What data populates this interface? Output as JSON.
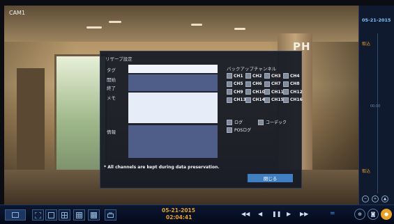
{
  "camera": {
    "label": "CAM1",
    "sign_text": "PH"
  },
  "dialog": {
    "title": "リザーブ設定",
    "fields": {
      "tag": "タグ",
      "start": "開始",
      "end": "終了",
      "memo": "メモ",
      "info": "情報"
    },
    "backup_title": "バックアップチャンネル",
    "channels": [
      "CH1",
      "CH2",
      "CH3",
      "CH4",
      "CH5",
      "CH6",
      "CH7",
      "CH8",
      "CH9",
      "CH10",
      "CH11",
      "CH12",
      "CH13",
      "CH14",
      "CH15",
      "CH16"
    ],
    "options": {
      "log": "ログ",
      "codec": "コーデック",
      "pos_log": "POSログ"
    },
    "note": "* All channels are kept during data preservation.",
    "close_label": "閉じる"
  },
  "timeline": {
    "date": "05-21-2015",
    "mark_top": "取込",
    "mark_bottom": "取込",
    "tick_mid": "00:00"
  },
  "toolbar": {
    "date": "05-21-2015",
    "time": "02:04:41"
  },
  "colors": {
    "accent": "#e8a228",
    "dialog_bg": "#161a26",
    "input_blue": "#4e5e88",
    "close_button": "#3f7fbf"
  },
  "icons": {
    "rewind": "rewind-icon",
    "step_back": "step-back-icon",
    "pause": "pause-icon",
    "step_forward": "step-forward-icon",
    "fast_forward": "fast-forward-icon",
    "zoom": "zoom-icon",
    "camera": "camera-icon",
    "record": "record-icon"
  }
}
